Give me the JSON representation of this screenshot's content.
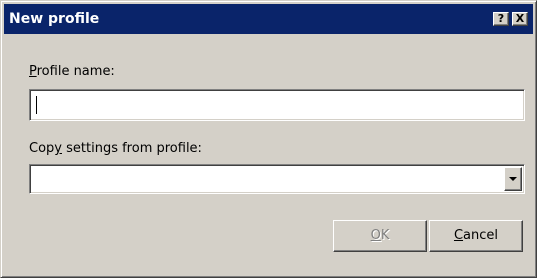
{
  "window": {
    "title": "New profile"
  },
  "titlebar": {
    "help_glyph": "?",
    "close_glyph": "X"
  },
  "profile_name": {
    "label_pre": "",
    "label_accel": "P",
    "label_post": "rofile name:",
    "value": ""
  },
  "copy_settings": {
    "label_pre": "Cop",
    "label_accel": "y",
    "label_post": " settings from profile:",
    "selected": ""
  },
  "buttons": {
    "ok": {
      "accel": "O",
      "post": "K",
      "enabled": false
    },
    "cancel": {
      "accel": "C",
      "post": "ancel",
      "enabled": true
    }
  },
  "colors": {
    "titlebar": "#0a246a",
    "face": "#d4d0c8",
    "disabled_text": "#808080"
  }
}
